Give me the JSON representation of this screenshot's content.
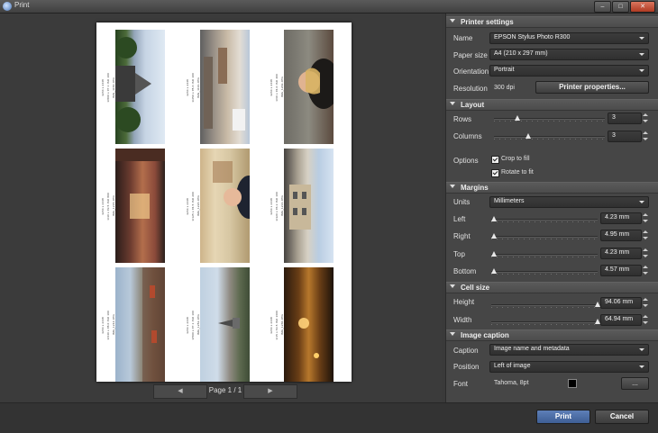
{
  "window": {
    "title": "Print",
    "controls": [
      "–",
      "□",
      "✕"
    ]
  },
  "preview": {
    "page_label": "Page 1 / 1",
    "prev_icon": "◀",
    "next_icon": "▶",
    "cell_captions": [
      {
        "name": "IMG_1184.JPG",
        "info": "1/800 s  f/7.1  ISO 100",
        "size": "3264 x 2448"
      },
      {
        "name": "IMG_1191.JPG",
        "info": "1/250 s  f/5.6  ISO 100",
        "size": "3264 x 2448"
      },
      {
        "name": "IMG_1202.JPG",
        "info": "1/60 s  f/4.0  ISO 400",
        "size": "3264 x 2448"
      },
      {
        "name": "IMG_1215.JPG",
        "info": "1/30 s  f/3.5  ISO 800",
        "size": "3264 x 2448"
      },
      {
        "name": "IMG_1226.JPG",
        "info": "1/125 s  f/4.5  ISO 200",
        "size": "3264 x 2448"
      },
      {
        "name": "IMG_1231.JPG",
        "info": "1/320 s  f/6.3  ISO 100",
        "size": "3264 x 2448"
      },
      {
        "name": "IMG_1244.JPG",
        "info": "1/640 s  f/8.0  ISO 100",
        "size": "3264 x 2448"
      },
      {
        "name": "IMG_1252.JPG",
        "info": "1/500 s  f/7.1  ISO 100",
        "size": "3264 x 2448"
      },
      {
        "name": "IMG_1260.JPG",
        "info": "1/15 s  f/3.5  ISO 1600",
        "size": "3264 x 2448"
      }
    ]
  },
  "printer_settings": {
    "header": "Printer settings",
    "name_label": "Name",
    "name_value": "EPSON Stylus Photo R300",
    "paper_label": "Paper size",
    "paper_value": "A4 (210 x 297 mm)",
    "orientation_label": "Orientation",
    "orientation_value": "Portrait",
    "resolution_label": "Resolution",
    "resolution_value": "300 dpi",
    "properties_button": "Printer properties..."
  },
  "layout": {
    "header": "Layout",
    "rows_label": "Rows",
    "rows_value": "3",
    "rows_fraction": 0.2,
    "columns_label": "Columns",
    "columns_value": "3",
    "columns_fraction": 0.3,
    "options_label": "Options",
    "crop_label": "Crop to fill",
    "crop_checked": true,
    "rotate_label": "Rotate to fit",
    "rotate_checked": true
  },
  "margins": {
    "header": "Margins",
    "units_label": "Units",
    "units_value": "Millimeters",
    "left_label": "Left",
    "left_value": "4.23 mm",
    "right_label": "Right",
    "right_value": "4.95 mm",
    "top_label": "Top",
    "top_value": "4.23 mm",
    "bottom_label": "Bottom",
    "bottom_value": "4.57 mm"
  },
  "cell_size": {
    "header": "Cell size",
    "height_label": "Height",
    "height_value": "94.06 mm",
    "width_label": "Width",
    "width_value": "64.94 mm"
  },
  "image_caption": {
    "header": "Image caption",
    "caption_label": "Caption",
    "caption_value": "Image name and metadata",
    "position_label": "Position",
    "position_value": "Left of image",
    "font_label": "Font",
    "font_value": "Tahoma, 8pt",
    "font_color": "#000000",
    "font_button": "..."
  },
  "footer": {
    "print_button": "Print",
    "cancel_button": "Cancel"
  }
}
